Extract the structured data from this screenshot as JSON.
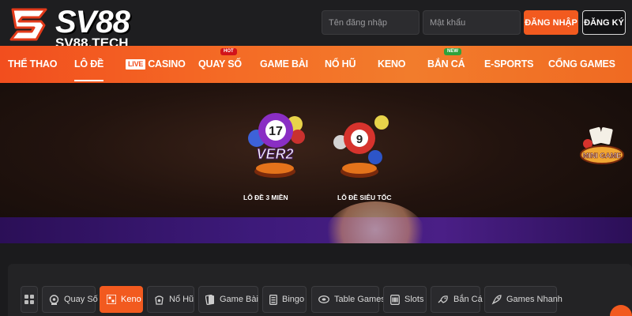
{
  "header": {
    "logo_text": "SV88",
    "logo_sub": "SV88.TECH",
    "username_placeholder": "Tên đăng nhập",
    "password_placeholder": "Mật khẩu",
    "login_label": "ĐĂNG NHẬP",
    "register_label": "ĐĂNG KÝ"
  },
  "nav": {
    "items": [
      {
        "label": "THỂ THAO"
      },
      {
        "label": "LÔ ĐỀ"
      },
      {
        "label": "CASINO",
        "badge": "LIVE"
      },
      {
        "label": "QUAY SỐ",
        "tag": "HOT"
      },
      {
        "label": "GAME BÀI"
      },
      {
        "label": "NỔ HŨ"
      },
      {
        "label": "KENO"
      },
      {
        "label": "BẮN CÁ",
        "tag": "NEW"
      },
      {
        "label": "E-SPORTS"
      },
      {
        "label": "CỔNG GAMES"
      }
    ]
  },
  "banner": {
    "games": [
      {
        "label": "LÔ ĐỀ 3 MIỀN",
        "icon": "lottery-balls-ver2-icon",
        "ball_number": "17",
        "ball_text": "VER2"
      },
      {
        "label": "LÔ ĐỀ SIÊU TỐC",
        "icon": "lottery-balls-fast-icon",
        "ball_number": "9"
      }
    ],
    "side_badge": "MINI GAME"
  },
  "categories": [
    {
      "label": "",
      "icon": "grid-icon"
    },
    {
      "label": "Quay Số",
      "icon": "lottery-icon"
    },
    {
      "label": "Keno",
      "icon": "keno-icon",
      "active": true
    },
    {
      "label": "Nổ Hũ",
      "icon": "jackpot-icon"
    },
    {
      "label": "Game Bài",
      "icon": "cards-icon"
    },
    {
      "label": "Bingo",
      "icon": "bingo-icon"
    },
    {
      "label": "Table Games",
      "icon": "table-icon"
    },
    {
      "label": "Slots",
      "icon": "slots-icon"
    },
    {
      "label": "Bắn Cá",
      "icon": "fish-icon"
    },
    {
      "label": "Games Nhanh",
      "icon": "rocket-icon"
    }
  ],
  "colors": {
    "accent": "#f25a1f",
    "nav_gradient_start": "#f24e1e",
    "header_bg": "#1e1e20",
    "banner_strip": "#3d1a7a"
  }
}
